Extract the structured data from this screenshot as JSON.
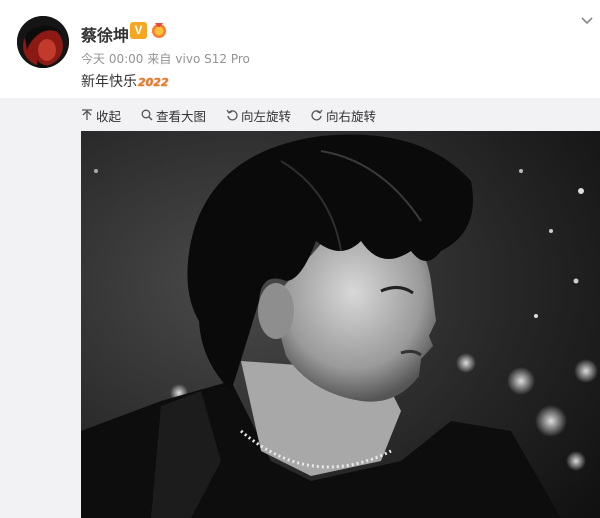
{
  "post": {
    "username": "蔡徐坤",
    "verified_badge": "V",
    "meta": {
      "time": "今天 00:00",
      "source_prefix": "来自",
      "device": "vivo S12 Pro"
    },
    "text": "新年快乐",
    "text_year": "2022"
  },
  "toolbar": {
    "items": [
      {
        "label": "收起",
        "icon": "collapse-up-icon"
      },
      {
        "label": "查看大图",
        "icon": "magnifier-icon"
      },
      {
        "label": "向左旋转",
        "icon": "rotate-left-icon"
      },
      {
        "label": "向右旋转",
        "icon": "rotate-right-icon"
      }
    ]
  },
  "colors": {
    "verified": "#f5a623",
    "meta_text": "#939393",
    "media_bg": "#f2f2f5"
  }
}
